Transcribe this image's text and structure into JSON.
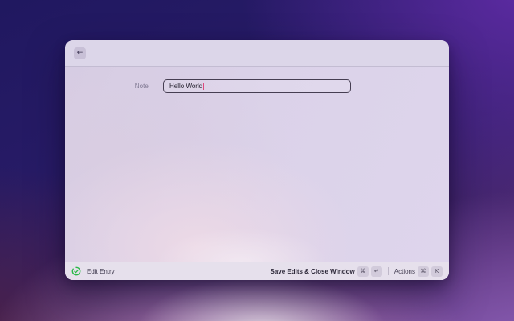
{
  "window": {
    "header": {
      "back_label": "←"
    },
    "form": {
      "note": {
        "label": "Note",
        "value": "Hello World"
      }
    },
    "footer": {
      "source_label": "Edit Entry",
      "primary": {
        "label": "Save Edits & Close Window",
        "keys": [
          "⌘",
          "↵"
        ]
      },
      "actions": {
        "label": "Actions",
        "keys": [
          "⌘",
          "K"
        ]
      }
    }
  },
  "colors": {
    "accent_green": "#2bb948",
    "caret": "#dd4b7e"
  }
}
